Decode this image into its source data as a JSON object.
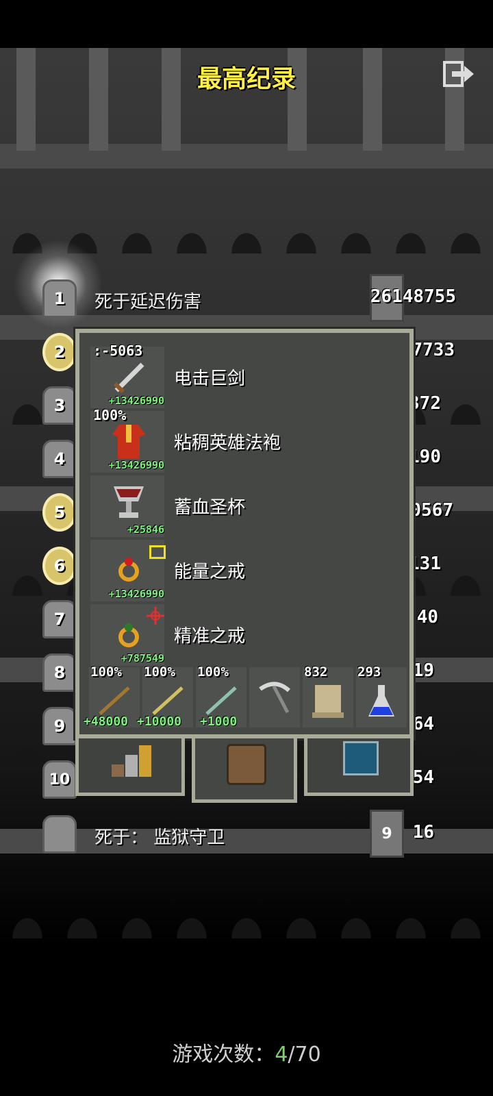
{
  "title": "最高纪录",
  "rankings": [
    {
      "rank": "1",
      "cause": "死于延迟伤害",
      "score": "26148755"
    },
    {
      "rank": "2",
      "cause": "",
      "score": "7733"
    },
    {
      "rank": "3",
      "cause": "",
      "score": "372"
    },
    {
      "rank": "4",
      "cause": "",
      "score": "190"
    },
    {
      "rank": "5",
      "cause": "",
      "score": "0567"
    },
    {
      "rank": "6",
      "cause": "",
      "score": "131"
    },
    {
      "rank": "7",
      "cause": "",
      "score": "40"
    },
    {
      "rank": "8",
      "cause": "",
      "score": "19"
    },
    {
      "rank": "9",
      "cause": "",
      "score": "64"
    },
    {
      "rank": "10",
      "cause": "",
      "score": "54"
    },
    {
      "rank": "",
      "cause": "死于：  监狱守卫",
      "score": "16",
      "hero_level": "9"
    }
  ],
  "items": [
    {
      "top": ":-5063",
      "bottom": "+13426990",
      "name": "电击巨剑",
      "icon": "sword-icon"
    },
    {
      "top": "100%",
      "bottom": "+13426990",
      "name": "粘稠英雄法袍",
      "icon": "robe-icon"
    },
    {
      "top": "",
      "bottom": "+25846",
      "name": "蓄血圣杯",
      "icon": "chalice-icon"
    },
    {
      "top": "",
      "bottom": "+13426990",
      "name": "能量之戒",
      "icon": "ring-icon"
    },
    {
      "top": "",
      "bottom": "+787549",
      "name": "精准之戒",
      "icon": "ring-icon"
    }
  ],
  "quickslots": [
    {
      "top": "100%",
      "bottom": "+48000",
      "icon": "wand-icon"
    },
    {
      "top": "100%",
      "bottom": "+10000",
      "icon": "wand-icon"
    },
    {
      "top": "100%",
      "bottom": "+1000",
      "icon": "wand-icon"
    },
    {
      "top": "",
      "bottom": "",
      "icon": "pickaxe-icon"
    },
    {
      "top": "832",
      "bottom": "",
      "icon": "scroll-icon"
    },
    {
      "top": "293",
      "bottom": "",
      "icon": "potion-icon"
    }
  ],
  "footer": {
    "label": "游戏次数：",
    "current": "4",
    "total": "/70"
  },
  "colors": {
    "title": "#ffee44",
    "bonus": "#7ef27e",
    "panel": "#444744",
    "panel_border": "#a8ab98"
  }
}
